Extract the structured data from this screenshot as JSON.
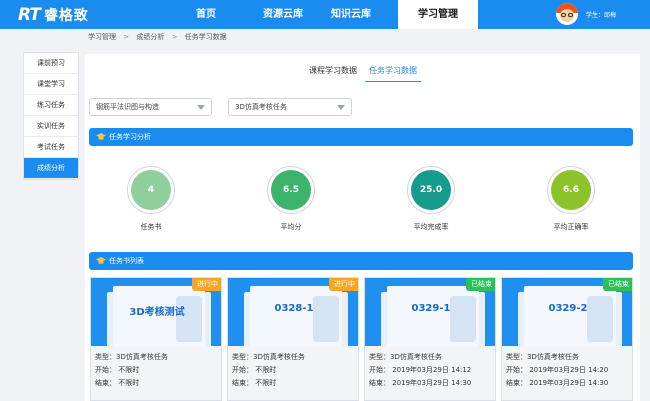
{
  "app": {
    "logo_latin": "RT",
    "logo_cn": "睿格致",
    "user_label": "学生：邱梅"
  },
  "nav": [
    {
      "label": "首页"
    },
    {
      "label": "资源云库"
    },
    {
      "label": "知识云库"
    },
    {
      "label": "学习管理",
      "active": true
    }
  ],
  "breadcrumb": [
    "学习管理",
    "成绩分析",
    "任务学习数据"
  ],
  "breadcrumb_sep": ">",
  "sidebar": {
    "items": [
      {
        "label": "课前预习"
      },
      {
        "label": "课堂学习"
      },
      {
        "label": "练习任务"
      },
      {
        "label": "实训任务"
      },
      {
        "label": "考试任务"
      },
      {
        "label": "成绩分析",
        "active": true
      }
    ]
  },
  "tabs": [
    {
      "label": "课程学习数据"
    },
    {
      "label": "任务学习数据",
      "active": true
    }
  ],
  "filters": {
    "course": "钢筋平法识图与构造",
    "task_type": "3D仿真考核任务"
  },
  "sections": {
    "analysis_title": "任务学习分析",
    "list_title": "任务书列表"
  },
  "stats": [
    {
      "value": "4",
      "label": "任务书",
      "color": "#8fcf9c"
    },
    {
      "value": "6.5",
      "label": "平均分",
      "color": "#3bb36a"
    },
    {
      "value": "25.0",
      "label": "平均完成率",
      "color": "#169c8a"
    },
    {
      "value": "6.6",
      "label": "平均正确率",
      "color": "#8cc22a"
    }
  ],
  "cards": [
    {
      "title": "3D考核测试",
      "status": "进行中",
      "status_kind": "ongoing",
      "type": "类型：3D仿真考核任务",
      "start": "开始： 不限时",
      "end": "结束： 不限时"
    },
    {
      "title": "0328-1",
      "status": "进行中",
      "status_kind": "ongoing",
      "type": "类型：3D仿真考核任务",
      "start": "开始： 不限时",
      "end": "结束： 不限时"
    },
    {
      "title": "0329-1",
      "status": "已结束",
      "status_kind": "ended",
      "type": "类型：3D仿真考核任务",
      "start": "开始： 2019年03月29日 14:12",
      "end": "结束： 2019年03月29日 14:30"
    },
    {
      "title": "0329-2",
      "status": "已结束",
      "status_kind": "ended",
      "type": "类型：3D仿真考核任务",
      "start": "开始： 2019年03月29日 14:20",
      "end": "结束： 2019年03月29日 14:30"
    }
  ],
  "colors": {
    "primary": "#1a8cf0",
    "ongoing": "#f5a623",
    "ended": "#2dbf5a"
  }
}
